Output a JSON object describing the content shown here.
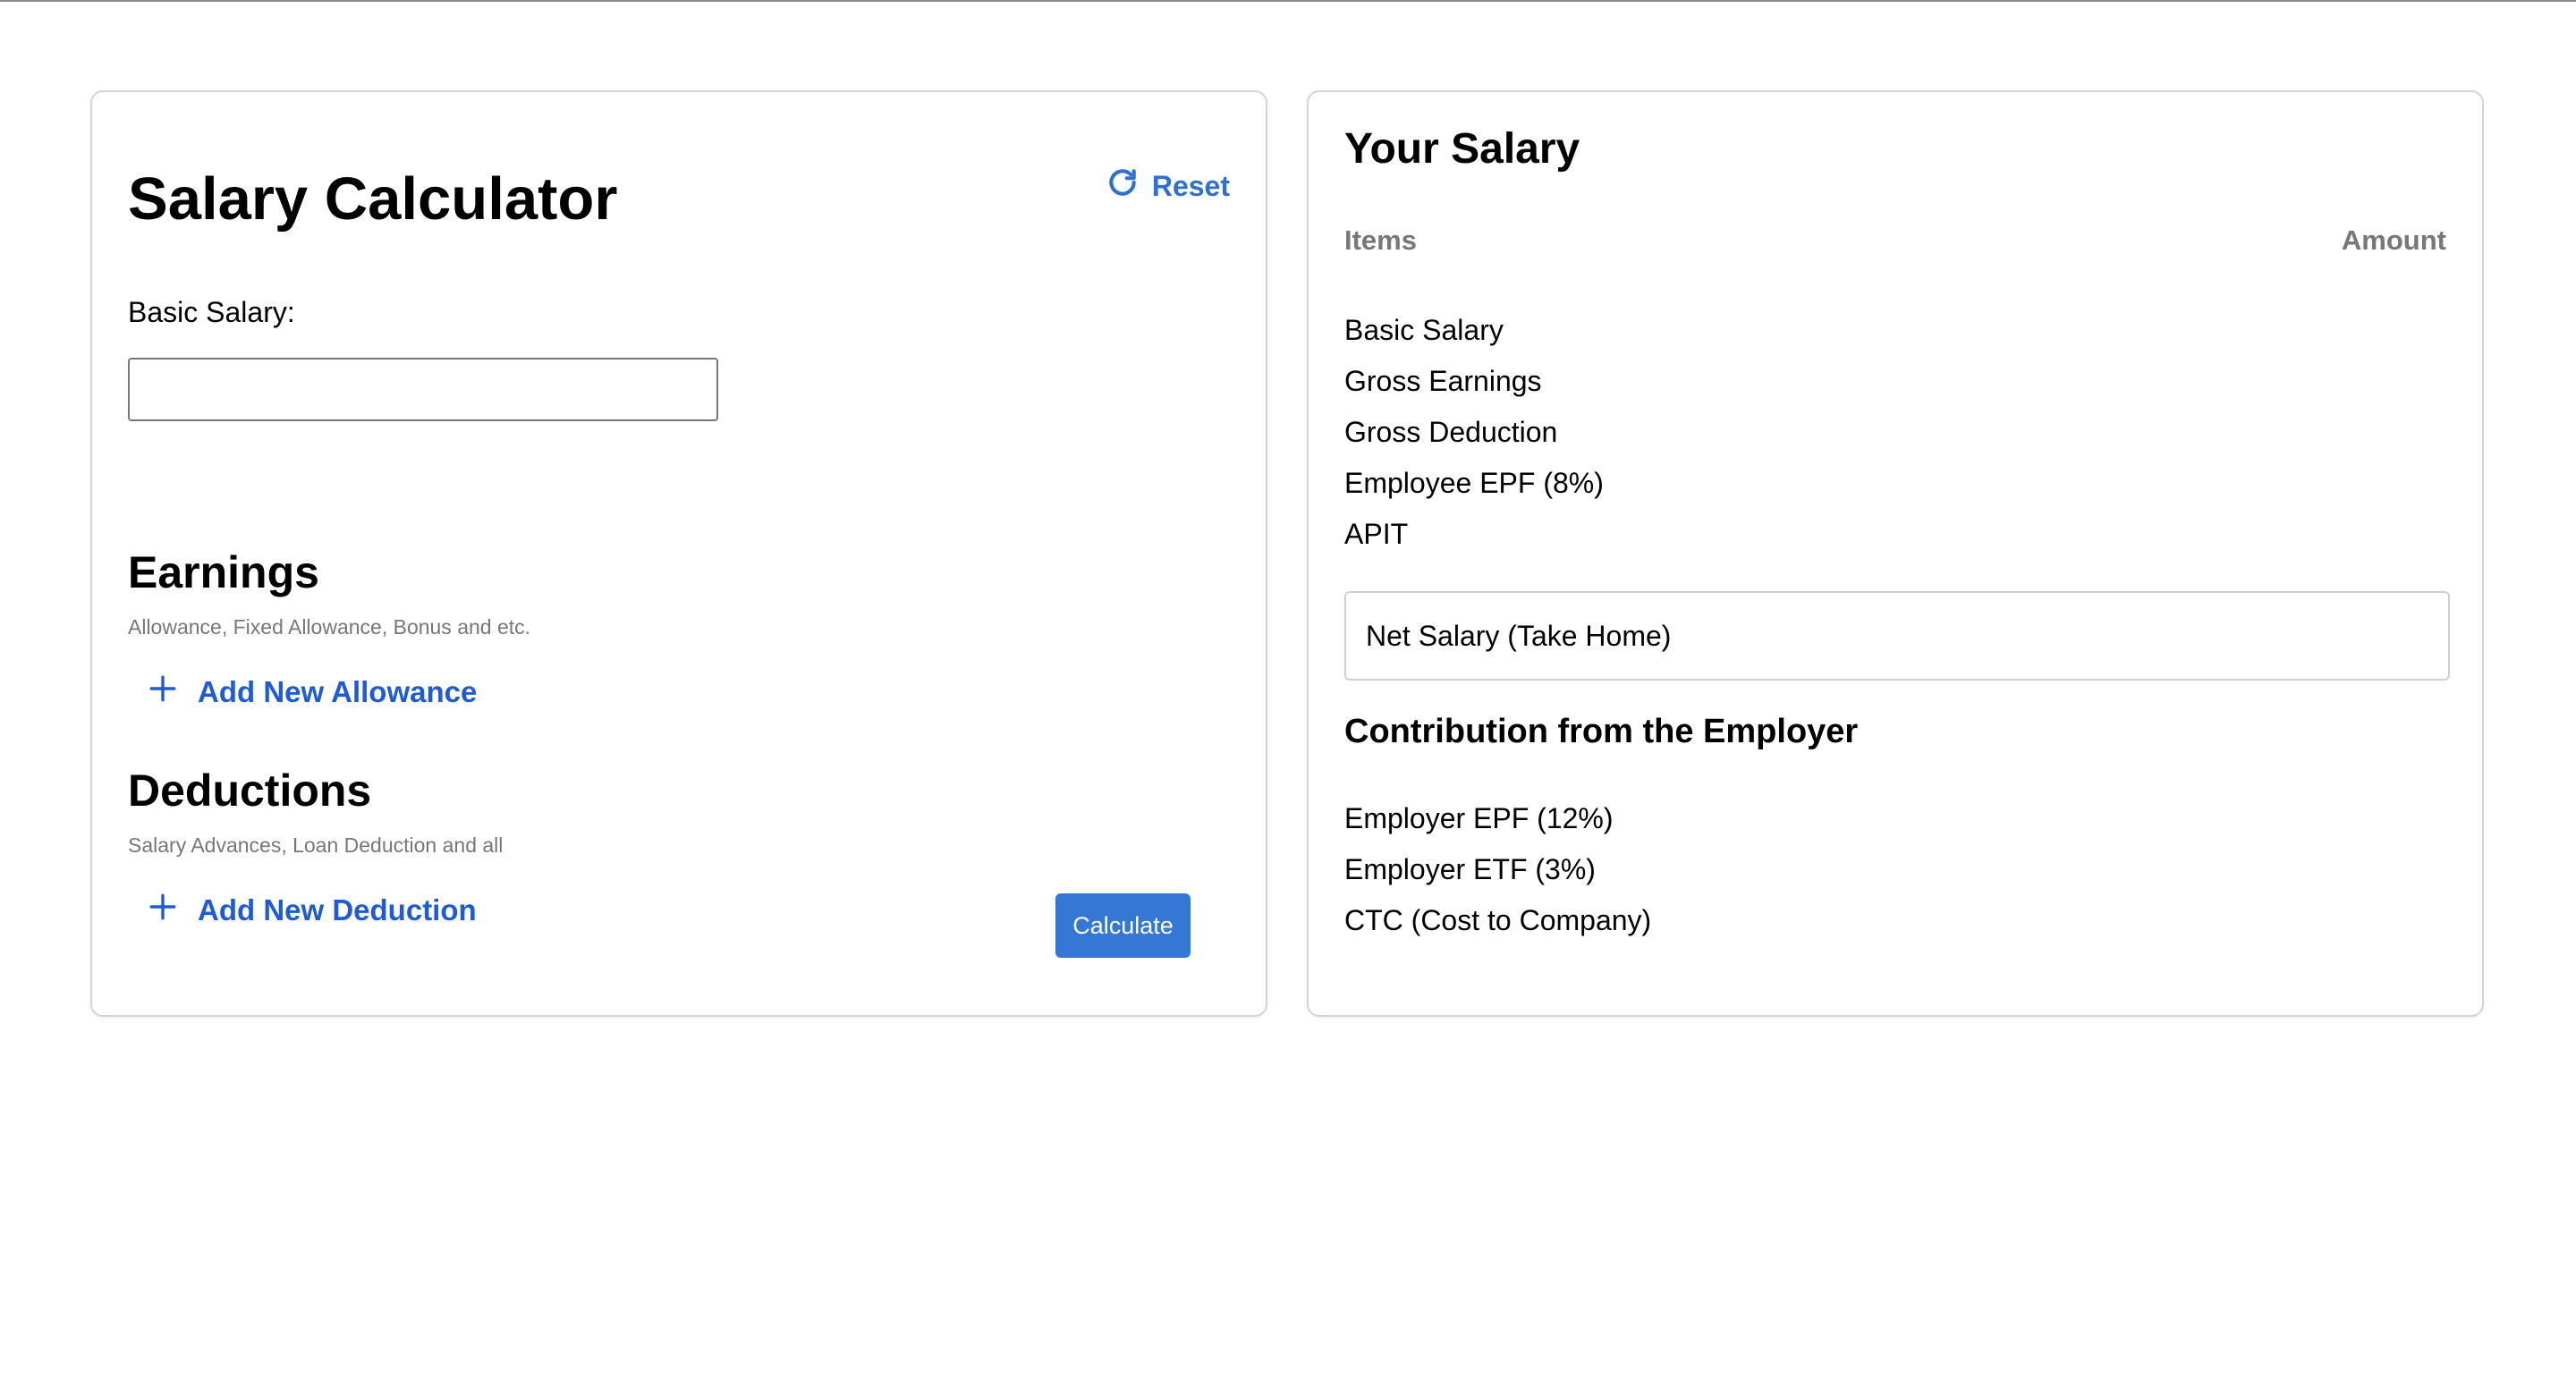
{
  "calculator": {
    "title": "Salary Calculator",
    "reset_label": "Reset",
    "basic_salary_label": "Basic Salary:",
    "basic_salary_value": "",
    "earnings": {
      "title": "Earnings",
      "subtitle": "Allowance, Fixed Allowance, Bonus and etc.",
      "add_label": "Add New Allowance"
    },
    "deductions": {
      "title": "Deductions",
      "subtitle": "Salary Advances, Loan Deduction and all",
      "add_label": "Add New Deduction"
    },
    "calculate_label": "Calculate"
  },
  "summary": {
    "title": "Your Salary",
    "col_items": "Items",
    "col_amount": "Amount",
    "items": [
      "Basic Salary",
      "Gross Earnings",
      "Gross Deduction",
      "Employee EPF (8%)",
      "APIT"
    ],
    "net_salary_label": "Net Salary (Take Home)",
    "employer": {
      "title": "Contribution from the Employer",
      "items": [
        "Employer EPF (12%)",
        "Employer ETF (3%)",
        "CTC (Cost to Company)"
      ]
    }
  },
  "colors": {
    "accent_link": "#1f5bd8",
    "reset": "#2f6fd3",
    "button": "#3577d4",
    "muted": "#777777"
  },
  "icons": {
    "reset": "refresh-icon",
    "add": "plus-icon"
  }
}
